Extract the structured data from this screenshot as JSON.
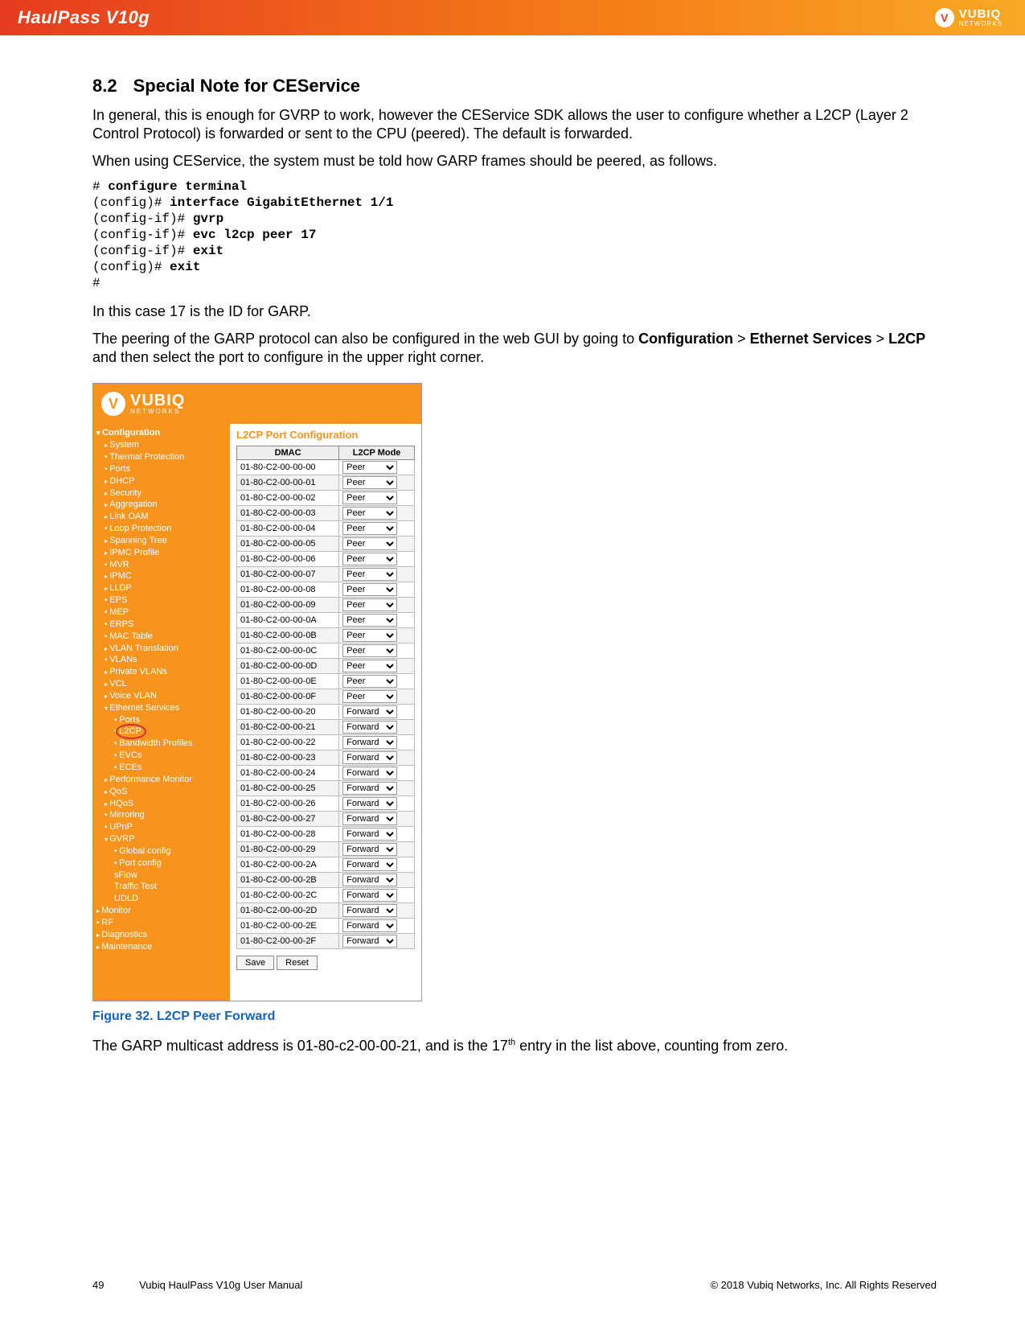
{
  "topbar": {
    "product": "HaulPass V10g",
    "brand": "VUBIQ",
    "brand_sub": "NETWORKS"
  },
  "section": {
    "number": "8.2",
    "title": "Special Note for CEService"
  },
  "para1": "In general, this is enough for GVRP to work, however the CEService SDK allows the user to configure whether a L2CP (Layer 2 Control Protocol) is forwarded or sent to the CPU (peered). The default is forwarded.",
  "para2": "When using CEService, the system must be told how GARP frames should be peered, as follows.",
  "cli": [
    {
      "p": "# ",
      "c": "configure terminal",
      "b": true
    },
    {
      "p": "(config)# ",
      "c": "interface GigabitEthernet 1/1",
      "b": true
    },
    {
      "p": "(config-if)# ",
      "c": "gvrp",
      "b": true
    },
    {
      "p": "(config-if)# ",
      "c": "evc l2cp peer 17",
      "b": true
    },
    {
      "p": "(config-if)# ",
      "c": "exit",
      "b": true
    },
    {
      "p": "(config)# ",
      "c": "exit",
      "b": true
    },
    {
      "p": "#",
      "c": "",
      "b": false
    }
  ],
  "para3": "In this case 17 is the ID for GARP.",
  "para4_a": "The peering of the GARP protocol can also be configured in the web GUI by going to ",
  "para4_b": "Configuration",
  "para4_c": " > ",
  "para4_d": "Ethernet Services",
  "para4_e": " > ",
  "para4_f": "L2CP",
  "para4_g": " and then select the port to configure in the upper right corner.",
  "gui": {
    "brand": "VUBIQ",
    "brand_sub": "NETWORKS",
    "panel_title": "L2CP Port Configuration",
    "col_dmac": "DMAC",
    "col_mode": "L2CP Mode",
    "nav": {
      "config": "Configuration",
      "items_l1": [
        "System",
        "Thermal Protection",
        "Ports",
        "DHCP",
        "Security",
        "Aggregation",
        "Link OAM",
        "Loop Protection",
        "Spanning Tree",
        "IPMC Profile",
        "MVR",
        "IPMC",
        "LLDP",
        "EPS",
        "MEP",
        "ERPS",
        "MAC Table",
        "VLAN Translation",
        "VLANs",
        "Private VLANs",
        "VCL",
        "Voice VLAN"
      ],
      "eth_services": "Ethernet Services",
      "eth_children": [
        "Ports",
        "L2CP",
        "Bandwidth Profiles",
        "EVCs",
        "ECEs"
      ],
      "after_eth": [
        "Performance Monitor",
        "QoS",
        "HQoS",
        "Mirroring",
        "UPnP"
      ],
      "gvrp": "GVRP",
      "gvrp_children": [
        "Global config",
        "Port config"
      ],
      "after_gvrp": [
        "sFlow",
        "Traffic Test",
        "UDLD"
      ],
      "monitor": "Monitor",
      "rf": "RF",
      "diag": "Diagnostics",
      "maint": "Maintenance"
    },
    "rows": [
      {
        "dmac": "01-80-C2-00-00-00",
        "mode": "Peer"
      },
      {
        "dmac": "01-80-C2-00-00-01",
        "mode": "Peer"
      },
      {
        "dmac": "01-80-C2-00-00-02",
        "mode": "Peer"
      },
      {
        "dmac": "01-80-C2-00-00-03",
        "mode": "Peer"
      },
      {
        "dmac": "01-80-C2-00-00-04",
        "mode": "Peer"
      },
      {
        "dmac": "01-80-C2-00-00-05",
        "mode": "Peer"
      },
      {
        "dmac": "01-80-C2-00-00-06",
        "mode": "Peer"
      },
      {
        "dmac": "01-80-C2-00-00-07",
        "mode": "Peer"
      },
      {
        "dmac": "01-80-C2-00-00-08",
        "mode": "Peer"
      },
      {
        "dmac": "01-80-C2-00-00-09",
        "mode": "Peer"
      },
      {
        "dmac": "01-80-C2-00-00-0A",
        "mode": "Peer"
      },
      {
        "dmac": "01-80-C2-00-00-0B",
        "mode": "Peer"
      },
      {
        "dmac": "01-80-C2-00-00-0C",
        "mode": "Peer"
      },
      {
        "dmac": "01-80-C2-00-00-0D",
        "mode": "Peer"
      },
      {
        "dmac": "01-80-C2-00-00-0E",
        "mode": "Peer"
      },
      {
        "dmac": "01-80-C2-00-00-0F",
        "mode": "Peer"
      },
      {
        "dmac": "01-80-C2-00-00-20",
        "mode": "Forward"
      },
      {
        "dmac": "01-80-C2-00-00-21",
        "mode": "Forward"
      },
      {
        "dmac": "01-80-C2-00-00-22",
        "mode": "Forward"
      },
      {
        "dmac": "01-80-C2-00-00-23",
        "mode": "Forward"
      },
      {
        "dmac": "01-80-C2-00-00-24",
        "mode": "Forward"
      },
      {
        "dmac": "01-80-C2-00-00-25",
        "mode": "Forward"
      },
      {
        "dmac": "01-80-C2-00-00-26",
        "mode": "Forward"
      },
      {
        "dmac": "01-80-C2-00-00-27",
        "mode": "Forward"
      },
      {
        "dmac": "01-80-C2-00-00-28",
        "mode": "Forward"
      },
      {
        "dmac": "01-80-C2-00-00-29",
        "mode": "Forward"
      },
      {
        "dmac": "01-80-C2-00-00-2A",
        "mode": "Forward"
      },
      {
        "dmac": "01-80-C2-00-00-2B",
        "mode": "Forward"
      },
      {
        "dmac": "01-80-C2-00-00-2C",
        "mode": "Forward"
      },
      {
        "dmac": "01-80-C2-00-00-2D",
        "mode": "Forward"
      },
      {
        "dmac": "01-80-C2-00-00-2E",
        "mode": "Forward"
      },
      {
        "dmac": "01-80-C2-00-00-2F",
        "mode": "Forward"
      }
    ],
    "save": "Save",
    "reset": "Reset"
  },
  "figcaption": "Figure 32. L2CP Peer Forward",
  "para5_a": "The GARP multicast address is 01-80-c2-00-00-21, and is the 17",
  "para5_sup": "th",
  "para5_b": " entry in the list above, counting from zero.",
  "footer": {
    "page": "49",
    "manual": "Vubiq HaulPass V10g User Manual",
    "copyright": "© 2018 Vubiq Networks, Inc. All Rights Reserved"
  }
}
